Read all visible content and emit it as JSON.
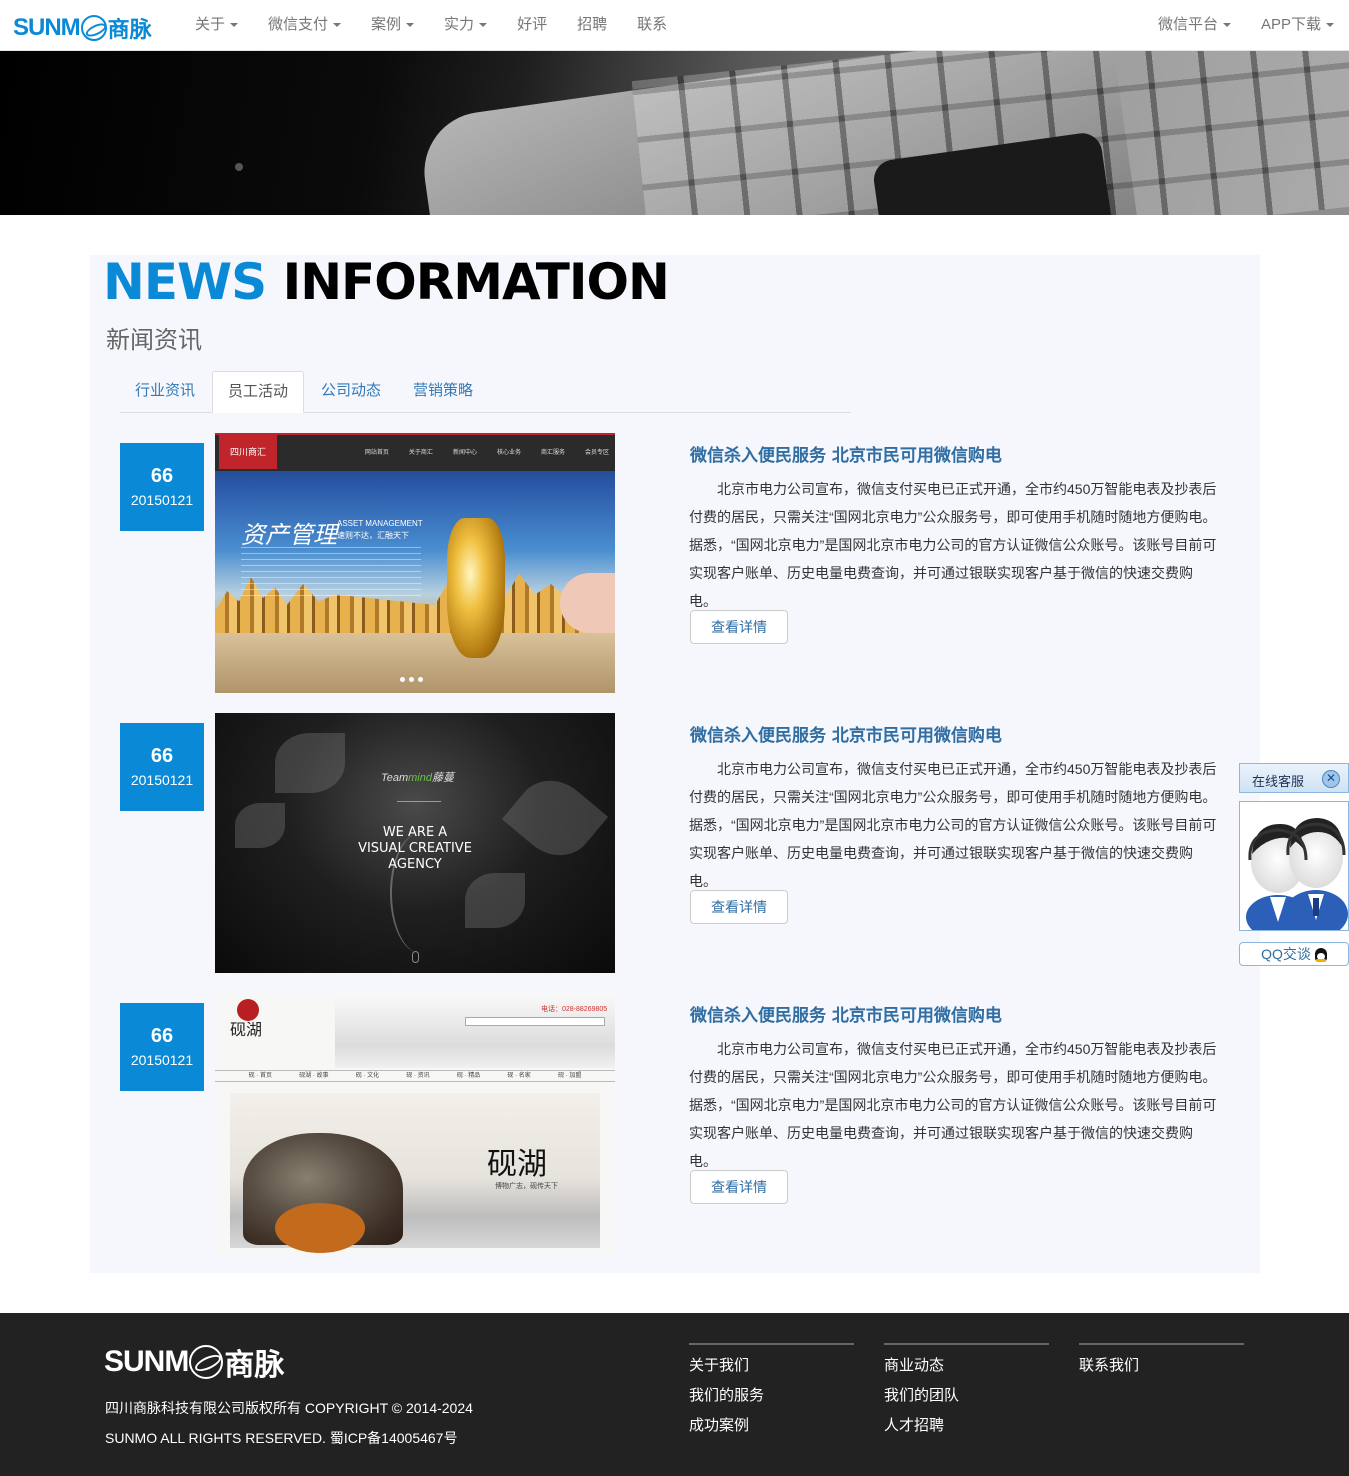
{
  "nav": {
    "logo_text": "SUNM",
    "logo_cn": "商脉",
    "left_items": [
      {
        "label": "关于",
        "dropdown": true
      },
      {
        "label": "微信支付",
        "dropdown": true
      },
      {
        "label": "案例",
        "dropdown": true
      },
      {
        "label": "实力",
        "dropdown": true
      },
      {
        "label": "好评",
        "dropdown": false
      },
      {
        "label": "招聘",
        "dropdown": false
      },
      {
        "label": "联系",
        "dropdown": false
      }
    ],
    "right_items": [
      {
        "label": "微信平台",
        "dropdown": true
      },
      {
        "label": "APP下载",
        "dropdown": true
      }
    ]
  },
  "section": {
    "heading_left": "NEWS",
    "heading_right": "INFORMATION",
    "subheading": "新闻资讯",
    "tabs": [
      "行业资讯",
      "员工活动",
      "公司动态",
      "营销策略"
    ],
    "active_tab": 1
  },
  "news": [
    {
      "num": "66",
      "date": "20150121",
      "title": "微信杀入便民服务 北京市民可用微信购电",
      "desc": "北京市电力公司宣布，微信支付买电已正式开通，全市约450万智能电表及抄表后付费的居民，只需关注“国网北京电力”公众服务号，即可使用手机随时随地方便购电。据悉，“国网北京电力”是国网北京市电力公司的官方认证微信公众账号。该账号目前可实现客户账单、历史电量电费查询，并可通过银联实现客户基于微信的快速交费购电。",
      "button": "查看详情",
      "thumb": {
        "logo": "四川商汇",
        "menu": [
          "网站首页",
          "关于商汇",
          "新闻中心",
          "核心业务",
          "商汇服务",
          "会员专区"
        ],
        "cn": "资产管理",
        "en": "ASSET MANAGEMENT",
        "sub": "速则不达，汇融天下"
      }
    },
    {
      "num": "66",
      "date": "20150121",
      "title": "微信杀入便民服务 北京市民可用微信购电",
      "desc": "北京市电力公司宣布，微信支付买电已正式开通，全市约450万智能电表及抄表后付费的居民，只需关注“国网北京电力”公众服务号，即可使用手机随时随地方便购电。据悉，“国网北京电力”是国网北京市电力公司的官方认证微信公众账号。该账号目前可实现客户账单、历史电量电费查询，并可通过银联实现客户基于微信的快速交费购电。",
      "button": "查看详情",
      "thumb": {
        "brand_a": "Team",
        "brand_b": "mind",
        "brand_c": "藤蔓",
        "line1": "WE ARE A",
        "line2": "VISUAL CREATIVE",
        "line3": "AGENCY"
      }
    },
    {
      "num": "66",
      "date": "20150121",
      "title": "微信杀入便民服务 北京市民可用微信购电",
      "desc": "北京市电力公司宣布，微信支付买电已正式开通，全市约450万智能电表及抄表后付费的居民，只需关注“国网北京电力”公众服务号，即可使用手机随时随地方便购电。据悉，“国网北京电力”是国网北京市电力公司的官方认证微信公众账号。该账号目前可实现客户账单、历史电量电费查询，并可通过银联实现客户基于微信的快速交费购电。",
      "button": "查看详情",
      "thumb": {
        "logo": "砚湖",
        "phone": "电话：028-88269805",
        "menu": [
          "砚 · 首页",
          "砚湖 · 故事",
          "砚 · 文化",
          "砚 · 资讯",
          "砚 · 精品",
          "砚 · 名家",
          "砚 · 加盟"
        ],
        "big": "砚湖",
        "small": "博物广志，砚传天下"
      }
    }
  ],
  "footer": {
    "logo_text": "SUNM",
    "logo_cn": "商脉",
    "copyright1": "四川商脉科技有限公司版权所有 COPYRIGHT © 2014-2024",
    "copyright2": "SUNMO ALL RIGHTS RESERVED. 蜀ICP备14005467号",
    "col1": [
      "关于我们",
      "我们的服务",
      "成功案例"
    ],
    "col2": [
      "商业动态",
      "我们的团队",
      "人才招聘"
    ],
    "col3": [
      "联系我们"
    ]
  },
  "service": {
    "title": "在线客服",
    "close": "✕",
    "qq": "QQ交谈"
  },
  "colors": {
    "brand": "#0a8ad6",
    "link": "#2f6da3",
    "footer_bg": "#222222"
  }
}
